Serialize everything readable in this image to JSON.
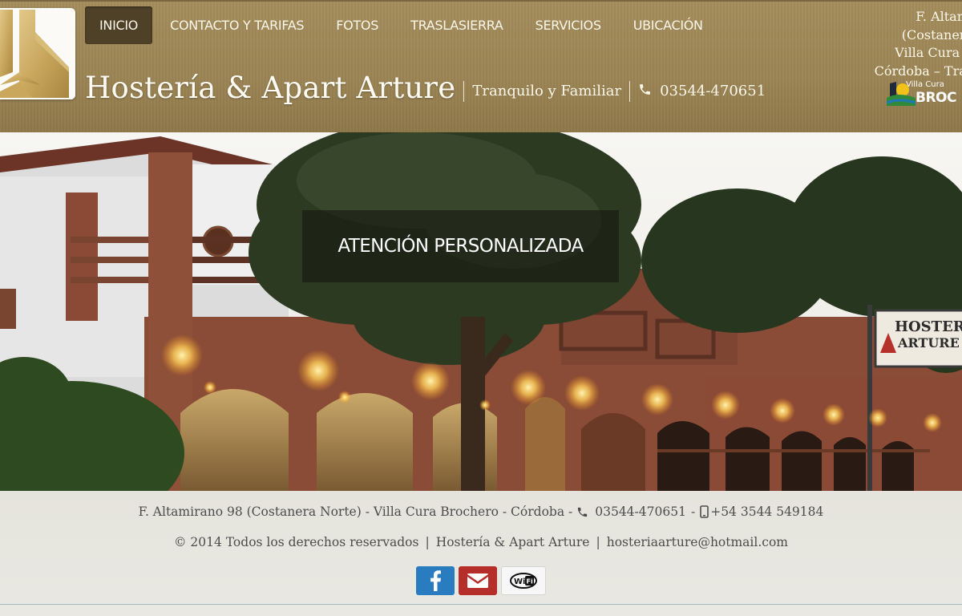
{
  "nav": {
    "items": [
      {
        "label": "INICIO",
        "active": true
      },
      {
        "label": "CONTACTO Y TARIFAS"
      },
      {
        "label": "FOTOS"
      },
      {
        "label": "TRASLASIERRA"
      },
      {
        "label": "SERVICIOS"
      },
      {
        "label": "UBICACIÓN"
      }
    ]
  },
  "brand": {
    "title": "Hostería & Apart Arture",
    "tagline": "Tranquilo y Familiar",
    "phone": "03544-470651"
  },
  "header_address": {
    "line1": "F. Altami",
    "line2": "(Costanera",
    "line3": "Villa Cura B",
    "line4": "Córdoba – Tras"
  },
  "town_logo": {
    "small": "Villa Cura",
    "big": "BROC"
  },
  "hero": {
    "caption": "ATENCIÓN PERSONALIZADA",
    "sign_text_1": "HOSTERIA",
    "sign_text_2": "ARTURE"
  },
  "footer": {
    "address": "F. Altamirano 98 (Costanera Norte) - Villa Cura Brochero - Córdoba -",
    "phone": "03544-470651",
    "dash": "-",
    "mobile": "+54 3544 549184",
    "copyright": "© 2014 Todos los derechos reservados",
    "separator": "|",
    "brand": "Hostería & Apart Arture",
    "email": "hosteriaarture@hotmail.com"
  },
  "social": {
    "icons": [
      "facebook-icon",
      "mail-icon",
      "wifi-icon"
    ]
  },
  "colors": {
    "header": "#9b8454",
    "nav_active": "#4f4128",
    "facebook": "#2a7cc0",
    "mail": "#b52e2a",
    "footer_bg": "#e7e6e0"
  }
}
